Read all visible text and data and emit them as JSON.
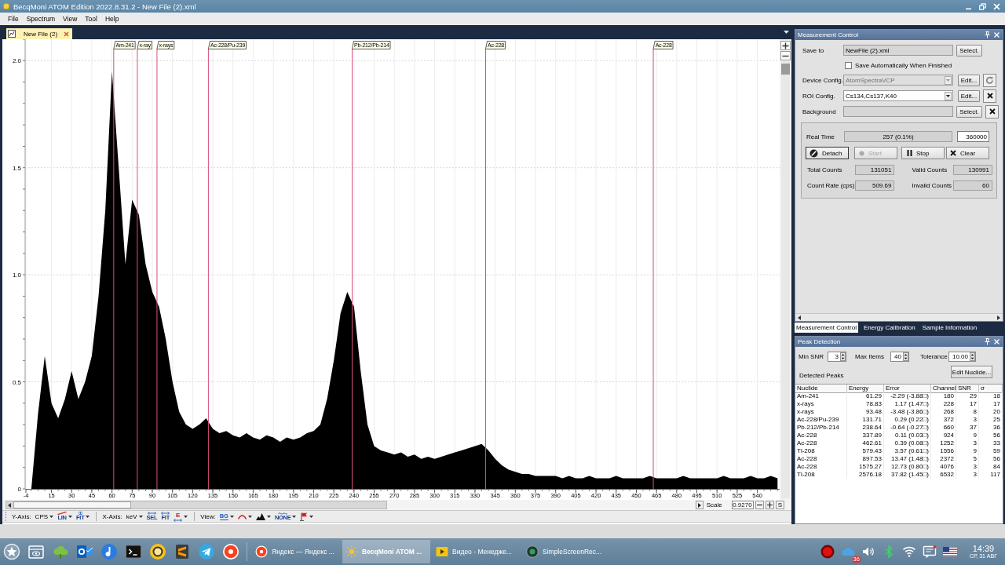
{
  "window": {
    "title": "BecqMoni ATOM Edition 2022.8.31.2 - New File (2).xml"
  },
  "menu": [
    "File",
    "Spectrum",
    "View",
    "Tool",
    "Help"
  ],
  "document_tabs": [
    {
      "label": "New File (2)",
      "selected": true
    }
  ],
  "spectrum": {
    "chart_data": {
      "type": "area",
      "x": [
        0,
        5,
        10,
        15,
        20,
        25,
        30,
        35,
        40,
        45,
        50,
        55,
        60,
        65,
        70,
        75,
        80,
        85,
        90,
        95,
        100,
        105,
        110,
        115,
        120,
        125,
        130,
        135,
        140,
        145,
        150,
        155,
        160,
        165,
        170,
        175,
        180,
        185,
        190,
        195,
        200,
        205,
        210,
        215,
        220,
        225,
        230,
        235,
        240,
        245,
        250,
        255,
        260,
        265,
        270,
        275,
        280,
        285,
        290,
        295,
        300,
        305,
        310,
        315,
        320,
        325,
        330,
        335,
        340,
        345,
        350,
        355,
        360,
        365,
        370,
        375,
        380,
        385,
        390,
        395,
        400,
        405,
        410,
        415,
        420,
        425,
        430,
        435,
        440,
        445,
        450,
        455,
        460,
        465,
        470,
        475,
        480,
        485,
        490,
        495,
        500,
        505,
        510,
        515,
        520,
        525,
        530,
        535,
        540,
        545,
        550,
        555
      ],
      "values": [
        0,
        0.35,
        0.62,
        0.4,
        0.33,
        0.42,
        0.55,
        0.42,
        0.5,
        0.62,
        0.9,
        1.3,
        1.95,
        1.5,
        1.05,
        1.35,
        1.28,
        1.05,
        0.92,
        0.85,
        0.7,
        0.5,
        0.36,
        0.3,
        0.28,
        0.3,
        0.33,
        0.28,
        0.26,
        0.27,
        0.25,
        0.24,
        0.26,
        0.24,
        0.23,
        0.25,
        0.24,
        0.22,
        0.24,
        0.23,
        0.24,
        0.26,
        0.27,
        0.3,
        0.42,
        0.6,
        0.82,
        0.92,
        0.85,
        0.55,
        0.3,
        0.2,
        0.18,
        0.17,
        0.16,
        0.17,
        0.15,
        0.16,
        0.14,
        0.15,
        0.14,
        0.15,
        0.16,
        0.17,
        0.18,
        0.19,
        0.2,
        0.21,
        0.18,
        0.14,
        0.11,
        0.09,
        0.08,
        0.07,
        0.07,
        0.06,
        0.06,
        0.06,
        0.06,
        0.05,
        0.06,
        0.05,
        0.05,
        0.06,
        0.05,
        0.05,
        0.05,
        0.06,
        0.05,
        0.05,
        0.05,
        0.05,
        0.06,
        0.05,
        0.05,
        0.05,
        0.05,
        0.06,
        0.05,
        0.05,
        0.05,
        0.05,
        0.05,
        0.06,
        0.05,
        0.05,
        0.05,
        0.06,
        0.05,
        0.05,
        0.06,
        0.05
      ],
      "xlim": [
        -4.6,
        556.6
      ],
      "ylim": [
        0,
        2.1
      ],
      "xticks": [
        {
          "value": -4,
          "label": "-4"
        },
        15,
        30,
        45,
        60,
        75,
        90,
        105,
        120,
        135,
        150,
        165,
        180,
        195,
        210,
        225,
        240,
        255,
        270,
        285,
        300,
        315,
        330,
        345,
        360,
        375,
        390,
        405,
        420,
        435,
        450,
        465,
        480,
        495,
        510,
        525,
        540
      ],
      "yticks": [
        0,
        {
          "value": 0.5,
          "label": "0.5"
        },
        {
          "value": 1,
          "label": "1.0"
        },
        {
          "value": 1.5,
          "label": "1.5"
        },
        {
          "value": 2,
          "label": "2.0"
        }
      ],
      "grid": true,
      "annotations": [
        "Am-241",
        "x-ray",
        "x-rays",
        "Ac-228/Pu-239",
        "Pb-212/Pb-214",
        "Ac-228",
        "Ac-228"
      ]
    },
    "scale": {
      "label": "Scale",
      "value": "0.9270",
      "button": "S"
    }
  },
  "toolbar": {
    "y_axis": {
      "label": "Y-Axis:",
      "unit": "CPS",
      "scale": "LIN",
      "fit": "FIT"
    },
    "x_axis": {
      "label": "X-Axis:",
      "unit": "keV",
      "select": "SEL",
      "fit": "FIT",
      "energy": "E"
    },
    "view": {
      "label": "View:",
      "background": "BG",
      "smoothing": "NONE"
    }
  },
  "measurement_control": {
    "title": "Measurement Control",
    "save_to": {
      "label": "Save to",
      "value": "NewFile (2).xml",
      "button": "Select."
    },
    "auto_save": {
      "label": "Save Automatically When Finished",
      "checked": false
    },
    "device_config": {
      "label": "Device Config.",
      "value": "AtomSpectraVCP",
      "disabled": true,
      "button": "Edit..."
    },
    "roi_config": {
      "label": "ROI Config.",
      "value": "Cs134,Cs137,K40",
      "disabled": false,
      "button": "Edit..."
    },
    "background": {
      "label": "Background",
      "button": "Select."
    },
    "real_time": {
      "label": "Real Time",
      "value": "257 (0.1%)",
      "limit": "360000"
    },
    "buttons": [
      {
        "label": "Detach",
        "disabled": false
      },
      {
        "label": "Start",
        "disabled": true
      },
      {
        "label": "Stop",
        "disabled": false
      },
      {
        "label": "Clear",
        "disabled": false
      }
    ],
    "counts": [
      {
        "label": "Total Counts",
        "value": "131051"
      },
      {
        "label": "Valid Counts",
        "value": "130991"
      },
      {
        "label": "Count Rate (cps)",
        "value": "509.69"
      },
      {
        "label": "Invalid Counts",
        "value": "60"
      }
    ]
  },
  "panel_tabs": [
    {
      "label": "Measurement Control",
      "selected": true
    },
    {
      "label": "Energy Calibration",
      "selected": false
    },
    {
      "label": "Sample Information",
      "selected": false
    }
  ],
  "peak_detection": {
    "title": "Peak Detection",
    "settings": [
      {
        "label": "Min SNR",
        "value": "3"
      },
      {
        "label": "Max Items",
        "value": "40"
      },
      {
        "label": "Tolerance",
        "value": "10.00"
      }
    ],
    "detected_label": "Detected Peaks",
    "edit_button": "Edit Nuclide...",
    "table": {
      "columns": [
        "Nuclide",
        "Energy",
        "Error",
        "Channel",
        "SNR",
        "σ"
      ],
      "rows": [
        [
          "Am-241",
          "61.29",
          "-2.29 (-3.88□)",
          "180",
          "29",
          "18"
        ],
        [
          "x-rays",
          "78.83",
          "1.17 (1.47□)",
          "228",
          "17",
          "17"
        ],
        [
          "x-rays",
          "93.48",
          "-3.48 (-3.86□)",
          "268",
          "8",
          "20"
        ],
        [
          "Ac-228/Pu-239",
          "131.71",
          "0.29 (0.22□)",
          "372",
          "3",
          "25"
        ],
        [
          "Pb-212/Pb-214",
          "238.64",
          "-0.64 (-0.27□)",
          "660",
          "37",
          "36"
        ],
        [
          "Ac-228",
          "337.89",
          "0.11 (0.03□)",
          "924",
          "9",
          "56"
        ],
        [
          "Ac-228",
          "462.61",
          "0.39 (0.08□)",
          "1252",
          "3",
          "33"
        ],
        [
          "Tl-208",
          "579.43",
          "3.57 (0.61□)",
          "1556",
          "9",
          "59"
        ],
        [
          "Ac-228",
          "897.53",
          "13.47 (1.48□)",
          "2372",
          "5",
          "56"
        ],
        [
          "Ac-228",
          "1575.27",
          "12.73 (0.80□)",
          "4076",
          "3",
          "84"
        ],
        [
          "Tl-208",
          "2576.18",
          "37.82 (1.45□)",
          "6532",
          "3",
          "117"
        ]
      ]
    }
  },
  "taskbar": {
    "tasks": [
      {
        "label": "Яндекс — Яндекс ...",
        "selected": false
      },
      {
        "label": "BecqMoni ATOM ...",
        "selected": true
      },
      {
        "label": "Видео - Менедже...",
        "selected": false
      },
      {
        "label": "SimpleScreenRec...",
        "selected": false
      }
    ],
    "tray_badge": "36",
    "clock": {
      "time": "14:39",
      "date": "СР, 31 АВГ"
    }
  }
}
